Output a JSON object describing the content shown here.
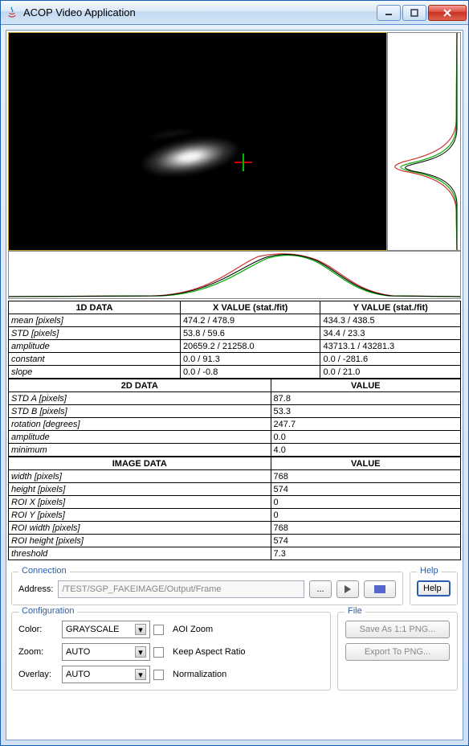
{
  "window": {
    "title": "ACOP Video Application"
  },
  "table_1d": {
    "headers": [
      "1D DATA",
      "X VALUE (stat./fit)",
      "Y VALUE (stat./fit)"
    ],
    "rows": [
      {
        "label": "mean [pixels]",
        "x": "474.2 / 478.9",
        "y": "434.3 / 438.5"
      },
      {
        "label": "STD [pixels]",
        "x": "53.8 / 59.6",
        "y": "34.4 / 23.3"
      },
      {
        "label": "amplitude",
        "x": "20659.2 / 21258.0",
        "y": "43713.1 / 43281.3"
      },
      {
        "label": "constant",
        "x": "0.0 / 91.3",
        "y": "0.0 / -281.6"
      },
      {
        "label": "slope",
        "x": "0.0 / -0.8",
        "y": "0.0 / 21.0"
      }
    ]
  },
  "table_2d": {
    "headers": [
      "2D DATA",
      "VALUE"
    ],
    "rows": [
      {
        "label": "STD A [pixels]",
        "v": "87.8"
      },
      {
        "label": "STD B [pixels]",
        "v": "53.3"
      },
      {
        "label": "rotation [degrees]",
        "v": "247.7"
      },
      {
        "label": "amplitude",
        "v": "0.0"
      },
      {
        "label": "minimum",
        "v": "4.0"
      }
    ]
  },
  "table_img": {
    "headers": [
      "IMAGE DATA",
      "VALUE"
    ],
    "rows": [
      {
        "label": "width [pixels]",
        "v": "768"
      },
      {
        "label": "height [pixels]",
        "v": "574"
      },
      {
        "label": "ROI X [pixels]",
        "v": "0"
      },
      {
        "label": "ROI Y [pixels]",
        "v": "0"
      },
      {
        "label": "ROI width [pixels]",
        "v": "768"
      },
      {
        "label": "ROI height [pixels]",
        "v": "574"
      },
      {
        "label": "threshold",
        "v": "7.3"
      }
    ]
  },
  "connection": {
    "legend": "Connection",
    "address_label": "Address:",
    "address_value": "/TEST/SGP_FAKEIMAGE/Output/Frame"
  },
  "help": {
    "legend": "Help",
    "button": "Help"
  },
  "config": {
    "legend": "Configuration",
    "color_label": "Color:",
    "color_value": "GRAYSCALE",
    "zoom_label": "Zoom:",
    "zoom_value": "AUTO",
    "overlay_label": "Overlay:",
    "overlay_value": "AUTO",
    "aoi_zoom": "AOI Zoom",
    "keep_aspect": "Keep Aspect Ratio",
    "normalization": "Normalization"
  },
  "file": {
    "legend": "File",
    "save_as": "Save As 1:1 PNG...",
    "export": "Export To PNG..."
  }
}
